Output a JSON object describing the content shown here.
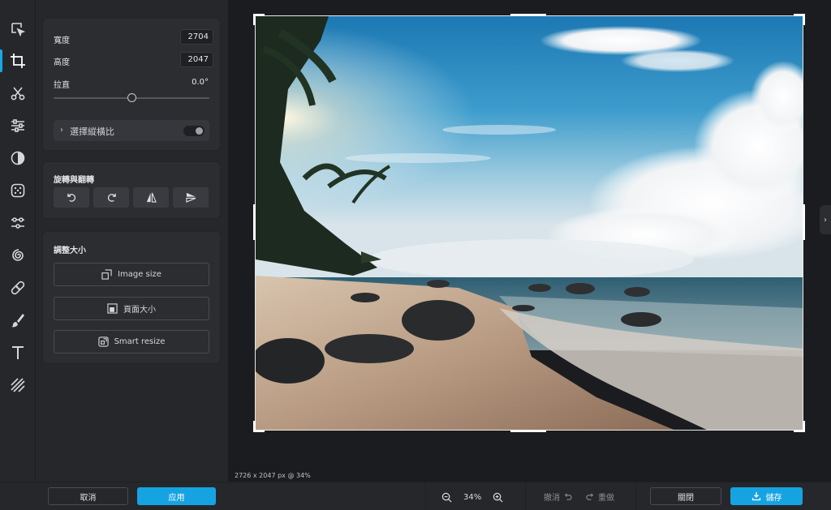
{
  "tools": [
    {
      "name": "select-tool",
      "icon": "cursor-icon"
    },
    {
      "name": "crop-tool",
      "icon": "crop-icon",
      "active": true
    },
    {
      "name": "cut-tool",
      "icon": "scissors-icon"
    },
    {
      "name": "adjust-tool",
      "icon": "sliders-icon"
    },
    {
      "name": "contrast-tool",
      "icon": "contrast-icon"
    },
    {
      "name": "effects-tool",
      "icon": "dots-grid-icon"
    },
    {
      "name": "filters-tool",
      "icon": "filter-nodes-icon"
    },
    {
      "name": "spiral-tool",
      "icon": "spiral-icon"
    },
    {
      "name": "bandage-tool",
      "icon": "bandage-icon"
    },
    {
      "name": "brush-tool",
      "icon": "brush-icon"
    },
    {
      "name": "text-tool",
      "icon": "text-icon"
    },
    {
      "name": "texture-tool",
      "icon": "texture-stripes-icon"
    }
  ],
  "crop": {
    "width_label": "寬度",
    "width_value": "2704",
    "height_label": "高度",
    "height_value": "2047",
    "straighten_label": "拉直",
    "straighten_value": "0.0°",
    "straighten_level": 0.5,
    "aspect_label": "選擇縱橫比",
    "aspect_enabled": false
  },
  "rotate": {
    "title": "旋轉與翻轉",
    "buttons": [
      "rotate-left-icon",
      "rotate-right-icon",
      "flip-horizontal-icon",
      "flip-vertical-icon"
    ]
  },
  "resize": {
    "title": "調整大小",
    "image_size": "Image size",
    "page_size": "頁面大小",
    "smart_resize": "Smart resize"
  },
  "canvas": {
    "dims_label": "2726 x 2047 px @ 34%"
  },
  "bottombar": {
    "cancel": "取消",
    "apply": "应用",
    "zoom": "34%",
    "undo": "撤消",
    "redo": "重做",
    "close": "關閉",
    "save": "儲存"
  },
  "colors": {
    "accent": "#16a3e2",
    "panel": "#26272b",
    "card": "#2c2d31",
    "canvas": "#1b1c1f"
  }
}
